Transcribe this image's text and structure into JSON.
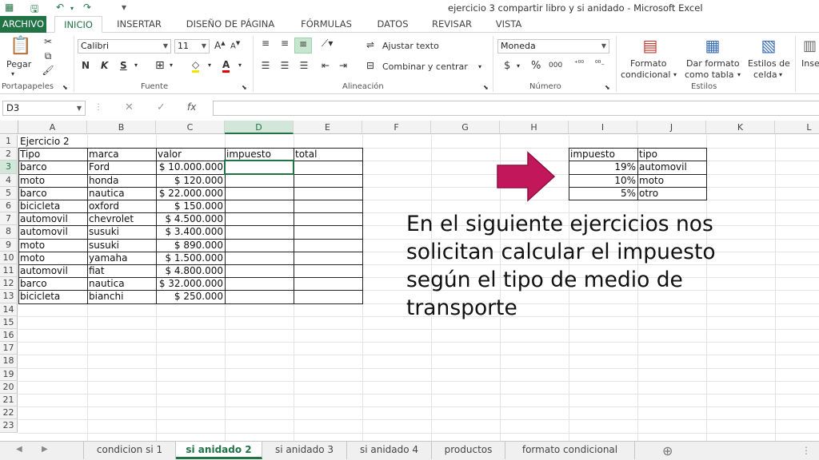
{
  "window": {
    "title": "ejercicio 3 compartir libro y si anidado - Microsoft Excel"
  },
  "tabs": [
    {
      "label": "ARCHIVO"
    },
    {
      "label": "INICIO"
    },
    {
      "label": "INSERTAR"
    },
    {
      "label": "DISEÑO DE PÁGINA"
    },
    {
      "label": "FÓRMULAS"
    },
    {
      "label": "DATOS"
    },
    {
      "label": "REVISAR"
    },
    {
      "label": "VISTA"
    }
  ],
  "ribbon": {
    "pegar": "Pegar",
    "font_name": "Calibri",
    "font_size": "11",
    "bold": "N",
    "italic": "K",
    "underline": "S",
    "ajustar_texto": "Ajustar texto",
    "combinar": "Combinar y centrar",
    "number_format": "Moneda",
    "currency": "$",
    "percent": "%",
    "thousands": "000",
    "formato_condicional_1": "Formato",
    "formato_condicional_2": "condicional",
    "dar_formato_1": "Dar formato",
    "dar_formato_2": "como tabla",
    "estilos_celda_1": "Estilos de",
    "estilos_celda_2": "celda",
    "insertar": "Inse",
    "groups": {
      "portapapeles": "Portapapeles",
      "fuente": "Fuente",
      "alineacion": "Alineación",
      "numero": "Número",
      "estilos": "Estilos"
    }
  },
  "formula_bar": {
    "name_box": "D3",
    "fx": "fx",
    "formula": ""
  },
  "sheet": {
    "columns": [
      "A",
      "B",
      "C",
      "D",
      "E",
      "F",
      "G",
      "H",
      "I",
      "J",
      "K",
      "L"
    ],
    "rows": [
      "1",
      "2",
      "3",
      "4",
      "5",
      "6",
      "7",
      "8",
      "9",
      "10",
      "11",
      "12",
      "13",
      "14",
      "15",
      "16",
      "17",
      "18",
      "19",
      "20",
      "21",
      "22",
      "23"
    ],
    "title": "Ejercicio 2",
    "headers": [
      "Tipo",
      "marca",
      "valor",
      "impuesto",
      "total"
    ],
    "data": [
      [
        "barco",
        "Ford",
        "$ 10.000.000"
      ],
      [
        "moto",
        "honda",
        "$ 120.000"
      ],
      [
        "barco",
        "nautica",
        "$ 22.000.000"
      ],
      [
        "bicicleta",
        "oxford",
        "$ 150.000"
      ],
      [
        "automovil",
        "chevrolet",
        "$ 4.500.000"
      ],
      [
        "automovil",
        "susuki",
        "$ 3.400.000"
      ],
      [
        "moto",
        "susuki",
        "$ 890.000"
      ],
      [
        "moto",
        "yamaha",
        "$ 1.500.000"
      ],
      [
        "automovil",
        "fiat",
        "$ 4.800.000"
      ],
      [
        "barco",
        "nautica",
        "$ 32.000.000"
      ],
      [
        "bicicleta",
        "bianchi",
        "$ 250.000"
      ]
    ],
    "tax_headers": [
      "impuesto",
      "tipo"
    ],
    "tax_table": [
      [
        "19%",
        "automovil"
      ],
      [
        "10%",
        "moto"
      ],
      [
        "5%",
        "otro"
      ]
    ]
  },
  "callout": "En el siguiente ejercicios nos solicitan calcular el impuesto según el tipo de medio de transporte",
  "sheet_tabs": [
    "condicion si 1",
    "si anidado 2",
    "si anidado 3",
    "si anidado 4",
    "productos",
    "formato condicional"
  ],
  "colors": {
    "excel_green": "#217346",
    "arrow": "#c2185b",
    "header_bg": "#f3f3f3"
  }
}
